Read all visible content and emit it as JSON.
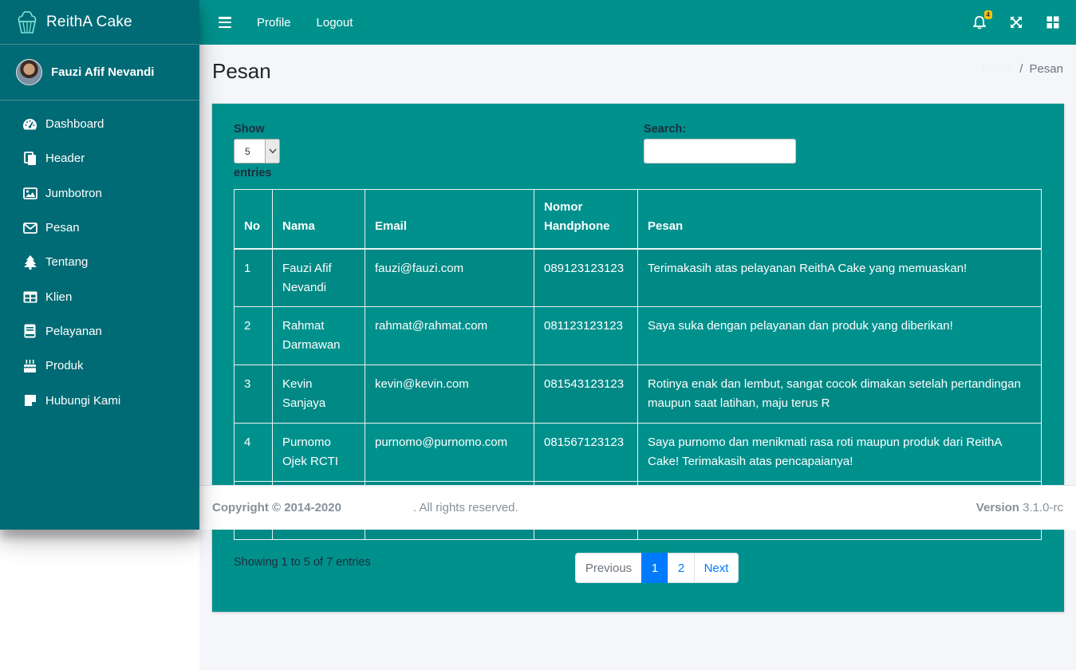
{
  "brand": {
    "name": "ReithA Cake"
  },
  "user": {
    "name": "Fauzi Afif Nevandi"
  },
  "sidebar": {
    "items": [
      {
        "label": "Dashboard",
        "icon": "tachometer-icon"
      },
      {
        "label": "Header",
        "icon": "copy-icon"
      },
      {
        "label": "Jumbotron",
        "icon": "image-icon"
      },
      {
        "label": "Pesan",
        "icon": "envelope-icon"
      },
      {
        "label": "Tentang",
        "icon": "tree-icon"
      },
      {
        "label": "Klien",
        "icon": "table-icon"
      },
      {
        "label": "Pelayanan",
        "icon": "book-icon"
      },
      {
        "label": "Produk",
        "icon": "birthday-cake-icon"
      },
      {
        "label": "Hubungi Kami",
        "icon": "sticky-note-icon"
      }
    ]
  },
  "topbar": {
    "profile": "Profile",
    "logout": "Logout",
    "notif_count": "4"
  },
  "page": {
    "title": "Pesan",
    "breadcrumb_home": "Home",
    "breadcrumb_sep": "/",
    "breadcrumb_current": "Pesan"
  },
  "table_controls": {
    "show_label": "Show",
    "entries_label": "entries",
    "page_size": "5",
    "search_label": "Search:",
    "search_value": ""
  },
  "table": {
    "headers": [
      "No",
      "Nama",
      "Email",
      "Nomor Handphone",
      "Pesan"
    ],
    "rows": [
      [
        "1",
        "Fauzi Afif Nevandi",
        "fauzi@fauzi.com",
        "089123123123",
        "Terimakasih atas pelayanan ReithA Cake yang memuaskan!"
      ],
      [
        "2",
        "Rahmat Darmawan",
        "rahmat@rahmat.com",
        "081123123123",
        "Saya suka dengan pelayanan dan produk yang diberikan!"
      ],
      [
        "3",
        "Kevin Sanjaya",
        "kevin@kevin.com",
        "081543123123",
        "Rotinya enak dan lembut, sangat cocok dimakan setelah pertandingan maupun saat latihan, maju terus R"
      ],
      [
        "4",
        "Purnomo Ojek RCTI",
        "purnomo@purnomo.com",
        "081567123123",
        "Saya purnomo dan menikmati rasa roti maupun produk dari ReithA Cake! Terimakasih atas pencapaianya!"
      ],
      [
        "",
        "",
        "",
        "",
        ""
      ]
    ]
  },
  "pagination": {
    "info": "Showing 1 to 5 of 7 entries",
    "previous": "Previous",
    "pages": [
      "1",
      "2"
    ],
    "next": "Next"
  },
  "footer": {
    "copyright": "Copyright © 2014-2020",
    "rights": ". All rights reserved.",
    "version_label": "Version",
    "version_value": "3.1.0-rc"
  },
  "colors": {
    "sidebar": "#006b75",
    "topbar": "#00918d",
    "card": "#00918d",
    "accent": "#007bff"
  }
}
